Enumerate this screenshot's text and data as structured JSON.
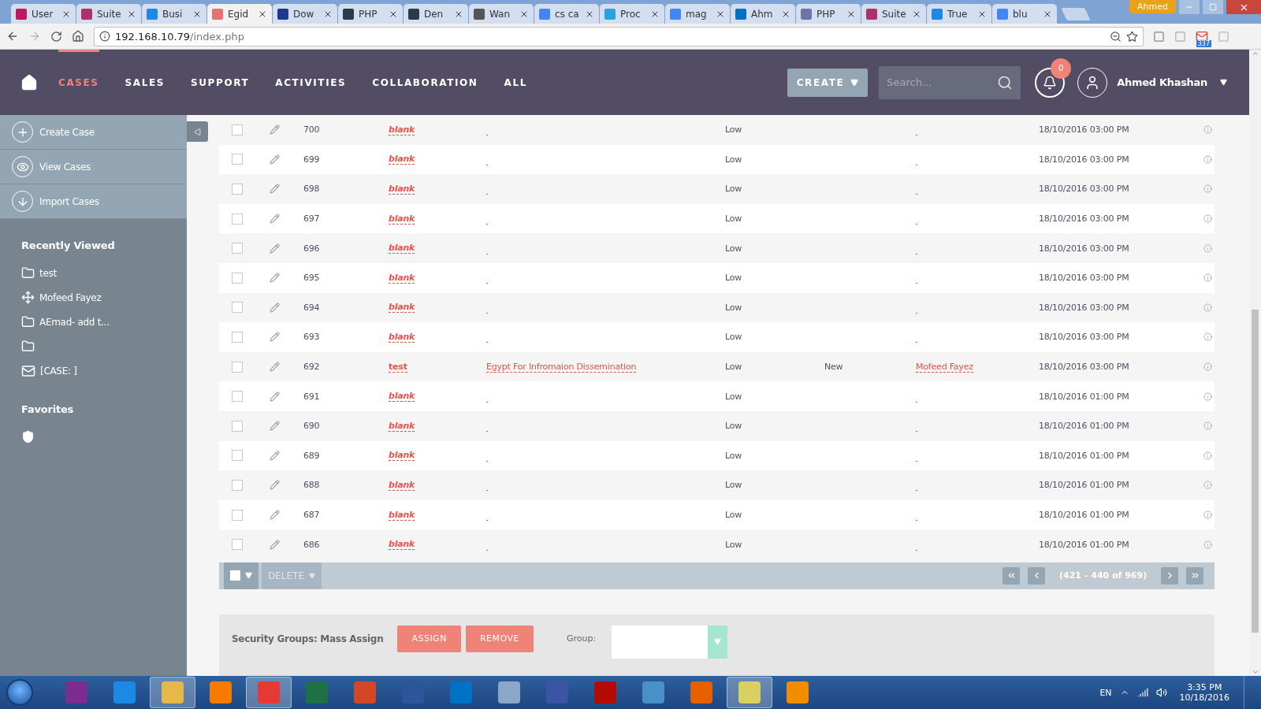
{
  "browser": {
    "tabs": [
      {
        "label": "User",
        "color": "#c2185b",
        "selected": false
      },
      {
        "label": "Suite",
        "color": "#b0306a",
        "selected": false
      },
      {
        "label": "Busi",
        "color": "#1e88e5",
        "selected": false
      },
      {
        "label": "Egid",
        "color": "#e57373",
        "selected": true
      },
      {
        "label": "Dow",
        "color": "#1a3a8f",
        "selected": false
      },
      {
        "label": "PHP",
        "color": "#2b3a4a",
        "selected": false
      },
      {
        "label": "Den",
        "color": "#2b3a4a",
        "selected": false
      },
      {
        "label": "Wan",
        "color": "#555555",
        "selected": false
      },
      {
        "label": "cs ca",
        "color": "#4285f4",
        "selected": false
      },
      {
        "label": "Proc",
        "color": "#29a3e0",
        "selected": false
      },
      {
        "label": "mag",
        "color": "#4285f4",
        "selected": false
      },
      {
        "label": "Ahm",
        "color": "#0072c6",
        "selected": false
      },
      {
        "label": "PHP",
        "color": "#6d75a8",
        "selected": false
      },
      {
        "label": "Suite",
        "color": "#b0306a",
        "selected": false
      },
      {
        "label": "True",
        "color": "#1e88e5",
        "selected": false
      },
      {
        "label": "blu",
        "color": "#4285f4",
        "selected": false
      }
    ],
    "profile": "Ahmed",
    "address": {
      "host": "192.168.10.79",
      "path": "/index.php"
    },
    "mail_badge": "337"
  },
  "nav": {
    "items": [
      {
        "label": "CASES",
        "selected": true
      },
      {
        "label": "SALES",
        "selected": false
      },
      {
        "label": "SUPPORT",
        "selected": false
      },
      {
        "label": "ACTIVITIES",
        "selected": false
      },
      {
        "label": "COLLABORATION",
        "selected": false
      },
      {
        "label": "ALL",
        "selected": false
      }
    ],
    "create": "CREATE",
    "search": {
      "placeholder": "Search..."
    },
    "notifications": "0",
    "user": "Ahmed Khashan"
  },
  "sidebar": {
    "actions": [
      {
        "label": "Create Case",
        "kind": "plus"
      },
      {
        "label": "View Cases",
        "kind": "eye"
      },
      {
        "label": "Import Cases",
        "kind": "download"
      }
    ],
    "recently_viewed": {
      "title": "Recently Viewed",
      "items": [
        {
          "label": "test",
          "kind": "folder"
        },
        {
          "label": "Mofeed Fayez",
          "kind": "move"
        },
        {
          "label": "AEmad- add t...",
          "kind": "folder"
        },
        {
          "kind": "folder"
        },
        {
          "label": "[CASE: ]",
          "kind": "mail"
        }
      ]
    },
    "favorites": {
      "title": "Favorites",
      "items": [
        {
          "kind": "shield"
        }
      ]
    }
  },
  "table": {
    "rows": [
      {
        "checked": false,
        "id": "700",
        "name": "blank",
        "name_empty": true,
        "priority": "Low",
        "date": "18/10/2016 03:00 PM"
      },
      {
        "checked": false,
        "id": "699",
        "name": "blank",
        "name_empty": true,
        "priority": "Low",
        "date": "18/10/2016 03:00 PM"
      },
      {
        "checked": false,
        "id": "698",
        "name": "blank",
        "name_empty": true,
        "priority": "Low",
        "date": "18/10/2016 03:00 PM"
      },
      {
        "checked": false,
        "id": "697",
        "name": "blank",
        "name_empty": true,
        "priority": "Low",
        "date": "18/10/2016 03:00 PM"
      },
      {
        "checked": false,
        "id": "696",
        "name": "blank",
        "name_empty": true,
        "priority": "Low",
        "date": "18/10/2016 03:00 PM"
      },
      {
        "checked": false,
        "id": "695",
        "name": "blank",
        "name_empty": true,
        "priority": "Low",
        "date": "18/10/2016 03:00 PM"
      },
      {
        "checked": false,
        "id": "694",
        "name": "blank",
        "name_empty": true,
        "priority": "Low",
        "date": "18/10/2016 03:00 PM"
      },
      {
        "checked": false,
        "id": "693",
        "name": "blank",
        "name_empty": true,
        "priority": "Low",
        "date": "18/10/2016 03:00 PM"
      },
      {
        "checked": false,
        "id": "692",
        "name": "test",
        "name_empty": false,
        "account": "Egypt For Infromaion Dissemination",
        "priority": "Low",
        "status": "New",
        "assigned": "Mofeed Fayez",
        "date": "18/10/2016 03:00 PM"
      },
      {
        "checked": false,
        "id": "691",
        "name": "blank",
        "name_empty": true,
        "priority": "Low",
        "date": "18/10/2016 01:00 PM"
      },
      {
        "checked": false,
        "id": "690",
        "name": "blank",
        "name_empty": true,
        "priority": "Low",
        "date": "18/10/2016 01:00 PM"
      },
      {
        "checked": false,
        "id": "689",
        "name": "blank",
        "name_empty": true,
        "priority": "Low",
        "date": "18/10/2016 01:00 PM"
      },
      {
        "checked": false,
        "id": "688",
        "name": "blank",
        "name_empty": true,
        "priority": "Low",
        "date": "18/10/2016 01:00 PM"
      },
      {
        "checked": false,
        "id": "687",
        "name": "blank",
        "name_empty": true,
        "priority": "Low",
        "date": "18/10/2016 01:00 PM"
      },
      {
        "checked": false,
        "id": "686",
        "name": "blank",
        "name_empty": true,
        "priority": "Low",
        "date": "18/10/2016 01:00 PM"
      }
    ],
    "bulk_action": "DELETE",
    "pagination": "(421 - 440 of 969)"
  },
  "security": {
    "label": "Security Groups: Mass Assign",
    "assign": "ASSIGN",
    "remove": "REMOVE",
    "group_label": "Group:"
  },
  "taskbar": {
    "apps": [
      {
        "color": "#7b2c8f",
        "selected": false
      },
      {
        "color": "#1e88e5",
        "selected": false
      },
      {
        "color": "#e6b84a",
        "selected": true
      },
      {
        "color": "#f57c00",
        "selected": false
      },
      {
        "color": "#e53935",
        "selected": true
      },
      {
        "color": "#1e7145",
        "selected": false
      },
      {
        "color": "#d24726",
        "selected": false
      },
      {
        "color": "#2b579a",
        "selected": false
      },
      {
        "color": "#0072c6",
        "selected": false
      },
      {
        "color": "#8aa6c8",
        "selected": false
      },
      {
        "color": "#3955a3",
        "selected": false
      },
      {
        "color": "#b30b00",
        "selected": false
      },
      {
        "color": "#4a90c8",
        "selected": false
      },
      {
        "color": "#e66000",
        "selected": false
      },
      {
        "color": "#d8d060",
        "selected": true
      },
      {
        "color": "#f28c00",
        "selected": false
      }
    ],
    "language": "EN",
    "time": "3:35 PM",
    "date": "10/18/2016"
  }
}
